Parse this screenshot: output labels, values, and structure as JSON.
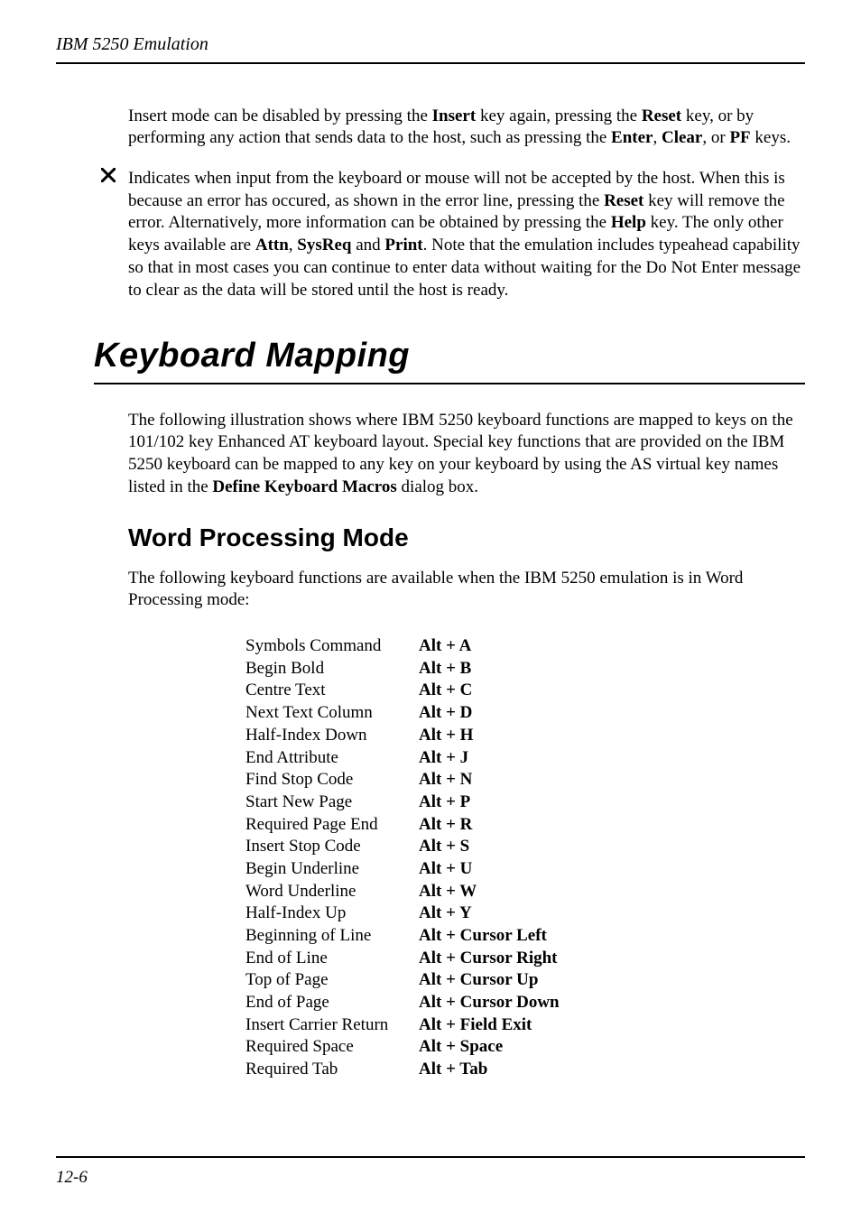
{
  "header": {
    "running_title": "IBM 5250 Emulation"
  },
  "intro": {
    "p1_1": "Insert mode can be disabled by pressing the ",
    "p1_b1": "Insert",
    "p1_2": " key again, pressing the ",
    "p1_b2": "Reset",
    "p1_3": " key, or by performing any action that sends data to the host, such as pressing the ",
    "p1_b3": "Enter",
    "p1_4": ", ",
    "p1_b4": "Clear",
    "p1_5": ", or ",
    "p1_b5": "PF",
    "p1_6": " keys."
  },
  "bullet": {
    "b_1": "Indicates when input from the keyboard or mouse will not be accepted by the host. When this is because an error has occured, as shown in the error line, pressing the ",
    "b_b1": "Reset",
    "b_2": " key will remove the error. Alternatively, more information can be obtained by pressing the ",
    "b_b2": "Help",
    "b_3": " key. The only other keys available are ",
    "b_b3": "Attn",
    "b_4": ", ",
    "b_b4": "SysReq",
    "b_5": " and ",
    "b_b5": "Print",
    "b_6": ". Note that the emulation includes typeahead capability so that in most cases you can continue to enter data without waiting for the Do Not Enter message to clear as the data will be stored until the host is ready."
  },
  "section": {
    "title": "Keyboard Mapping",
    "p_1": "The following illustration shows where IBM 5250 keyboard functions are mapped to keys on the 101/102 key Enhanced AT keyboard layout. Special key functions that are provided on the IBM 5250 keyboard can be mapped to any key on your keyboard by using the AS virtual key names listed in the ",
    "p_b1": "Define Keyboard Macros",
    "p_2": " dialog box."
  },
  "subsection": {
    "title": "Word Processing Mode",
    "desc": "The following keyboard functions are available when the IBM 5250 emulation is in Word Processing mode:"
  },
  "kbd_rows": [
    {
      "label": "Symbols Command",
      "key": "Alt + A"
    },
    {
      "label": "Begin Bold",
      "key": "Alt + B"
    },
    {
      "label": "Centre Text",
      "key": "Alt + C"
    },
    {
      "label": "Next Text Column",
      "key": "Alt + D"
    },
    {
      "label": "Half-Index Down",
      "key": "Alt + H"
    },
    {
      "label": "End Attribute",
      "key": "Alt + J"
    },
    {
      "label": "Find Stop Code",
      "key": "Alt + N"
    },
    {
      "label": "Start New Page",
      "key": "Alt + P"
    },
    {
      "label": "Required Page End",
      "key": "Alt + R"
    },
    {
      "label": "Insert Stop Code",
      "key": "Alt + S"
    },
    {
      "label": "Begin Underline",
      "key": "Alt + U"
    },
    {
      "label": "Word Underline",
      "key": "Alt + W"
    },
    {
      "label": "Half-Index Up",
      "key": "Alt + Y"
    },
    {
      "label": "Beginning of Line",
      "key": "Alt + Cursor Left"
    },
    {
      "label": "End of Line",
      "key": "Alt + Cursor Right"
    },
    {
      "label": "Top of Page",
      "key": "Alt + Cursor Up"
    },
    {
      "label": "End of Page",
      "key": "Alt + Cursor Down"
    },
    {
      "label": "Insert Carrier Return",
      "key": "Alt + Field Exit"
    },
    {
      "label": "Required Space",
      "key": "Alt + Space"
    },
    {
      "label": "Required Tab",
      "key": "Alt + Tab"
    }
  ],
  "footer": {
    "page": "12-6"
  }
}
